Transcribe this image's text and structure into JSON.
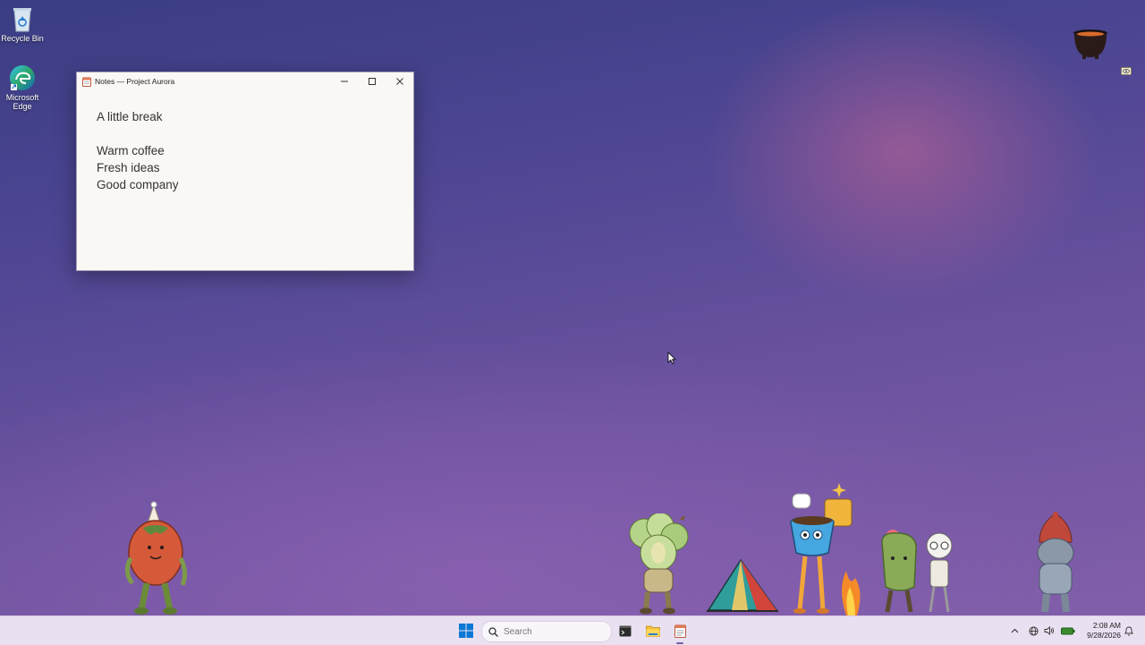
{
  "desktop": {
    "icons": [
      {
        "label": "Recycle Bin",
        "icon": "recycle-bin-icon"
      },
      {
        "label": "Microsoft Edge",
        "icon": "edge-icon"
      }
    ]
  },
  "window": {
    "title": "Notes — Project Aurora",
    "icon": "notepad-icon",
    "controls": {
      "minimize": "minimize-icon",
      "maximize": "maximize-icon",
      "close": "close-icon"
    },
    "content": {
      "heading": "A little break",
      "lines": [
        "Warm coffee",
        "Fresh ideas",
        "Good company"
      ]
    }
  },
  "taskbar": {
    "start_icon": "windows-logo-icon",
    "search_placeholder": "Search",
    "apps": [
      "terminal-icon",
      "file-explorer-icon",
      "notepad-icon"
    ],
    "tray": [
      "chevron-up-icon",
      "network-icon",
      "volume-icon",
      "battery-icon",
      "notification-icon"
    ],
    "time": "2:08 AM",
    "date": "9/28/2026"
  },
  "colors": {
    "accent": "#7a5aa6",
    "wallpaper": "#5b4b9a",
    "taskbar": "#e9e1f1"
  }
}
